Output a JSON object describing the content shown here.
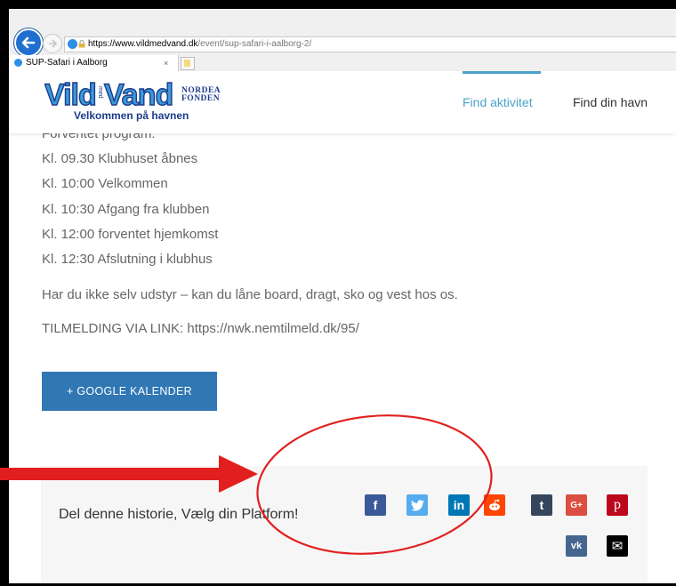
{
  "browser": {
    "url_host": "https://www.vildmedvand.dk",
    "url_path": "/event/sup-safari-i-aalborg-2/",
    "tab_title": "SUP-Safari i Aalborg",
    "tab_close": "×"
  },
  "site": {
    "logo_text": "VildVand",
    "logo_med": "med",
    "logo_sub": "Velkommen på havnen",
    "partner_line1": "NORDEA",
    "partner_line2": "FONDEN",
    "nav": [
      {
        "label": "Find aktivitet",
        "active": true
      },
      {
        "label": "Find din havn",
        "active": false
      }
    ]
  },
  "event": {
    "program_heading": "Forventet program:",
    "program": [
      "Kl. 09.30 Klubhuset åbnes",
      "Kl. 10:00 Velkommen",
      "Kl. 10:30 Afgang fra klubben",
      "Kl. 12:00 forventet hjemkomst",
      "Kl. 12:30 Afslutning i klubhus"
    ],
    "equipment_note": "Har du ikke selv udstyr – kan du låne board, dragt, sko og vest hos os.",
    "signup": "TILMELDING VIA LINK: https://nwk.nemtilmeld.dk/95/",
    "calendar_button": "+ GOOGLE KALENDER"
  },
  "share": {
    "text": "Del denne historie, Vælg din Platform!",
    "buttons": [
      {
        "name": "facebook",
        "glyph": "f",
        "color": "#3b5998"
      },
      {
        "name": "twitter",
        "glyph": "t",
        "color": "#55acee"
      },
      {
        "name": "linkedin",
        "glyph": "in",
        "color": "#0077b5"
      },
      {
        "name": "reddit",
        "glyph": "r",
        "color": "#ff4500"
      },
      {
        "name": "tumblr",
        "glyph": "t",
        "color": "#35465c"
      },
      {
        "name": "google-plus",
        "glyph": "G+",
        "color": "#dc4e41"
      },
      {
        "name": "pinterest",
        "glyph": "p",
        "color": "#bd081c"
      },
      {
        "name": "vk",
        "glyph": "vk",
        "color": "#45668e"
      },
      {
        "name": "email",
        "glyph": "✉",
        "color": "#000000"
      }
    ]
  },
  "colors": {
    "accent": "#4ba3c8",
    "button": "#3077b4",
    "annotation": "#e21f1f"
  }
}
